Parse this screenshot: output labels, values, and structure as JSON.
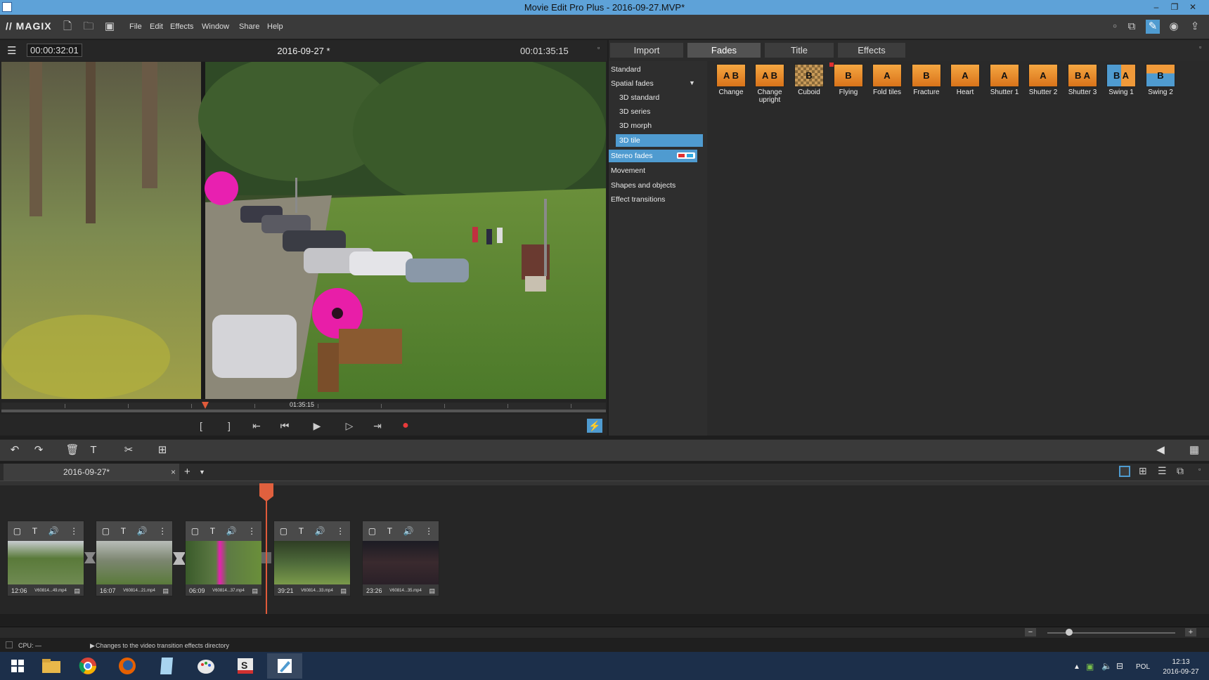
{
  "window": {
    "title": "Movie Edit Pro Plus - 2016-09-27.MVP*",
    "minimize": "–",
    "restore": "❐",
    "close": "✕"
  },
  "menu": {
    "logo": "// MAGIX",
    "items": [
      "File",
      "Edit",
      "Effects",
      "Window",
      "Share",
      "Help"
    ]
  },
  "preview": {
    "timecode_current": "00:00:32:01",
    "title": "2016-09-27 *",
    "timecode_total": "00:01:35:15",
    "sweep_time": "01:35:15",
    "playhead_fraction": 0.335
  },
  "right_panel": {
    "tabs": [
      "Import",
      "Fades",
      "Title",
      "Effects"
    ],
    "active_tab": "Fades",
    "categories": [
      {
        "label": "Standard",
        "indent": false
      },
      {
        "label": "Spatial fades",
        "indent": false,
        "expanded": true
      },
      {
        "label": "3D standard",
        "indent": true
      },
      {
        "label": "3D series",
        "indent": true
      },
      {
        "label": "3D morph",
        "indent": true
      },
      {
        "label": "3D tile",
        "indent": true,
        "selected": true
      },
      {
        "label": "Stereo fades",
        "indent": false,
        "stereo": true
      },
      {
        "label": "Movement",
        "indent": false
      },
      {
        "label": "Shapes and objects",
        "indent": false
      },
      {
        "label": "Effect transitions",
        "indent": false
      }
    ],
    "effects": [
      {
        "label": "Change",
        "glyph": "A B"
      },
      {
        "label": "Change upright",
        "glyph": "A B"
      },
      {
        "label": "Cuboid",
        "glyph": "B"
      },
      {
        "label": "Flying",
        "glyph": "B"
      },
      {
        "label": "Fold tiles",
        "glyph": "A"
      },
      {
        "label": "Fracture",
        "glyph": "B"
      },
      {
        "label": "Heart",
        "glyph": "A"
      },
      {
        "label": "Shutter 1",
        "glyph": "A"
      },
      {
        "label": "Shutter 2",
        "glyph": "A"
      },
      {
        "label": "Shutter 3",
        "glyph": "B A"
      },
      {
        "label": "Swing 1",
        "glyph": "B A"
      },
      {
        "label": "Swing 2",
        "glyph": "B"
      }
    ]
  },
  "timeline": {
    "project_tab": "2016-09-27*",
    "clips": [
      {
        "duration": "12:06",
        "name": "V60814...49.mp4",
        "color": "#6f8a52"
      },
      {
        "duration": "16:07",
        "name": "V60814...21.mp4",
        "color": "#7c8670"
      },
      {
        "duration": "06:09",
        "name": "V60814...37.mp4",
        "color": "#5d7a44"
      },
      {
        "duration": "39:21",
        "name": "V60814...33.mp4",
        "color": "#4e6a3a"
      },
      {
        "duration": "23:26",
        "name": "V60814...35.mp4",
        "color": "#3a2a2e"
      }
    ]
  },
  "status": {
    "cpu": "CPU: —",
    "message": "Changes to the video transition effects directory"
  },
  "taskbar": {
    "language": "POL",
    "time": "12:13",
    "date": "2016-09-27"
  },
  "colors": {
    "accent": "#4f9bd0",
    "playhead": "#e05a3a",
    "effect_orange": "#f09a3a",
    "record": "#e83a3a"
  }
}
